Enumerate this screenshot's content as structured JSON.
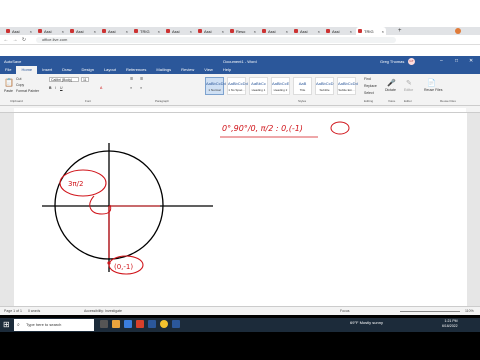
{
  "browser": {
    "tabs": [
      {
        "label": "Assi"
      },
      {
        "label": "Assi"
      },
      {
        "label": "Assi"
      },
      {
        "label": "Assi"
      },
      {
        "label": "TRIG"
      },
      {
        "label": "Assi"
      },
      {
        "label": "Assi"
      },
      {
        "label": "Reso"
      },
      {
        "label": "Assi"
      },
      {
        "label": "Assi"
      },
      {
        "label": "Assi"
      },
      {
        "label": "TRIG"
      }
    ],
    "address": "office.live.com",
    "new_tab": "+"
  },
  "word": {
    "title": "Document1 - Word",
    "user_name": "Greg Thomas",
    "user_initials": "GT",
    "autosave_label": "AutoSave",
    "menu": [
      "File",
      "Home",
      "Insert",
      "Draw",
      "Design",
      "Layout",
      "References",
      "Mailings",
      "Review",
      "View",
      "Help"
    ],
    "clipboard": {
      "paste": "Paste",
      "cut": "Cut",
      "copy": "Copy",
      "format_painter": "Format Painter",
      "group": "Clipboard"
    },
    "font": {
      "name": "Calibri (Body)",
      "size": "11",
      "group": "Font"
    },
    "paragraph_group": "Paragraph",
    "styles": [
      {
        "preview": "AaBbCcDd",
        "name": "1 Normal"
      },
      {
        "preview": "AaBbCcDd",
        "name": "1 No Spac..."
      },
      {
        "preview": "AaBbCc",
        "name": "Heading 1"
      },
      {
        "preview": "AaBbCcE",
        "name": "Heading 2"
      },
      {
        "preview": "AaB",
        "name": "Title"
      },
      {
        "preview": "AaBbCcD",
        "name": "Subtitle"
      },
      {
        "preview": "AaBbCcDd",
        "name": "Subtle Em..."
      }
    ],
    "styles_group": "Styles",
    "editing": {
      "find": "Find",
      "replace": "Replace",
      "select": "Select",
      "group": "Editing"
    },
    "voice": {
      "label": "Dictate",
      "group": "Voice"
    },
    "editor": {
      "label": "Editor",
      "group": "Editor"
    },
    "reuse": {
      "label": "Reuse Files",
      "group": "Reuse Files"
    },
    "status": {
      "page": "Page 1 of 1",
      "words": "0 words",
      "accessibility": "Accessibility: Investigate",
      "focus": "Focus",
      "zoom": "110%"
    }
  },
  "drawing": {
    "annotation": "0°,90°/0, π/2 : 0,(-1)",
    "circle_label_top": "3π/2",
    "point_label": "(0,-1)",
    "ink_color": "#d0141a",
    "pen_color": "#000000"
  },
  "taskbar": {
    "search_placeholder": "Type here to search",
    "weather": "69°F  Mostly sunny",
    "time": "1:21 PM",
    "date": "6/16/2022"
  }
}
